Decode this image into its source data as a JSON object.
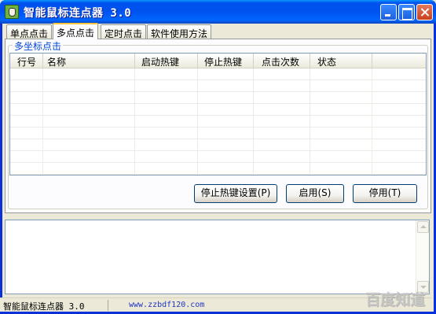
{
  "window": {
    "title": "智能鼠标连点器 3.0"
  },
  "tabs": [
    {
      "label": "单点点击"
    },
    {
      "label": "多点点击"
    },
    {
      "label": "定时点击"
    },
    {
      "label": "软件使用方法"
    }
  ],
  "group": {
    "label": "多坐标点击"
  },
  "list": {
    "columns": [
      "行号",
      "名称",
      "启动热键",
      "停止热键",
      "点击次数",
      "状态"
    ],
    "rows": []
  },
  "buttons": {
    "stop_hotkey": "停止热键设置(P)",
    "enable": "启用(S)",
    "disable": "停用(T)"
  },
  "statusbar": {
    "app_name": "智能鼠标连点器 3.0",
    "url": "www.zzbdf120.com"
  },
  "watermark": "百度知道"
}
